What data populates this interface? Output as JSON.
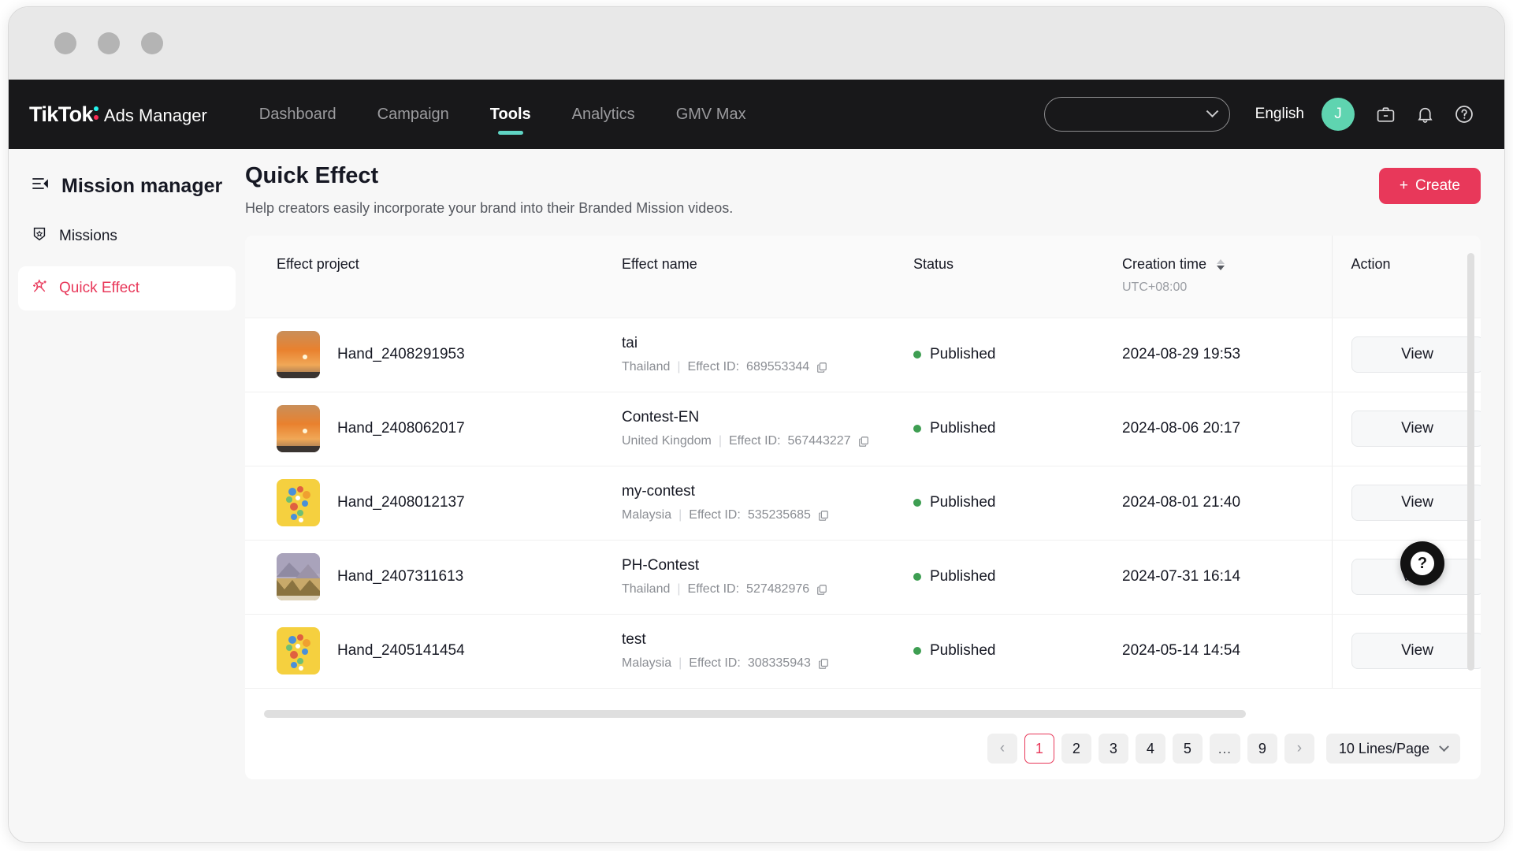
{
  "window": {
    "dots": [
      "window-dot-1",
      "window-dot-2",
      "window-dot-3"
    ]
  },
  "topnav": {
    "brand_primary": "TikTok",
    "brand_secondary": "Ads Manager",
    "items": [
      {
        "label": "Dashboard",
        "active": false
      },
      {
        "label": "Campaign",
        "active": false
      },
      {
        "label": "Tools",
        "active": true
      },
      {
        "label": "Analytics",
        "active": false
      },
      {
        "label": "GMV Max",
        "active": false
      }
    ],
    "account_select_value": "",
    "language": "English",
    "avatar_initial": "J",
    "icons": [
      "briefcase-icon",
      "bell-icon",
      "help-circle-icon"
    ],
    "accent_color": "#5fd4c4",
    "avatar_color": "#5fd4b0"
  },
  "sidebar": {
    "title": "Mission manager",
    "items": [
      {
        "label": "Missions",
        "icon": "shield-icon",
        "active": false
      },
      {
        "label": "Quick Effect",
        "icon": "sparkle-star-icon",
        "active": true
      }
    ],
    "active_color": "#e8385a"
  },
  "page": {
    "title": "Quick Effect",
    "subtitle": "Help creators easily incorporate your brand into their Branded Mission videos.",
    "create_label": "Create",
    "create_plus": "+",
    "create_color": "#e8385a"
  },
  "table": {
    "columns": [
      {
        "key": "effect_project",
        "label": "Effect project"
      },
      {
        "key": "effect_name",
        "label": "Effect name"
      },
      {
        "key": "status",
        "label": "Status"
      },
      {
        "key": "creation_time",
        "label": "Creation time",
        "sub": "UTC+08:00",
        "sortable": true
      },
      {
        "key": "action",
        "label": "Action"
      }
    ],
    "effect_id_prefix": "Effect ID:",
    "status_dot_color": "#3e9e52",
    "action_label": "View",
    "rows": [
      {
        "project": "Hand_2408291953",
        "thumb": "sunset",
        "name": "tai",
        "region": "Thailand",
        "effect_id": "689553344",
        "status": "Published",
        "creation_time": "2024-08-29 19:53",
        "action": "View"
      },
      {
        "project": "Hand_2408062017",
        "thumb": "sunset",
        "name": "Contest-EN",
        "region": "United Kingdom",
        "effect_id": "567443227",
        "status": "Published",
        "creation_time": "2024-08-06 20:17",
        "action": "View"
      },
      {
        "project": "Hand_2408012137",
        "thumb": "collage",
        "name": "my-contest",
        "region": "Malaysia",
        "effect_id": "535235685",
        "status": "Published",
        "creation_time": "2024-08-01 21:40",
        "action": "View"
      },
      {
        "project": "Hand_2407311613",
        "thumb": "mountain",
        "name": "PH-Contest",
        "region": "Thailand",
        "effect_id": "527482976",
        "status": "Published",
        "creation_time": "2024-07-31 16:14",
        "action": "View"
      },
      {
        "project": "Hand_2405141454",
        "thumb": "collage",
        "name": "test",
        "region": "Malaysia",
        "effect_id": "308335943",
        "status": "Published",
        "creation_time": "2024-05-14 14:54",
        "action": "View"
      }
    ]
  },
  "pagination": {
    "prev": "‹",
    "next": "›",
    "pages": [
      "1",
      "2",
      "3",
      "4",
      "5",
      "…",
      "9"
    ],
    "current": "1",
    "page_size": "10 Lines/Page"
  },
  "fab": {
    "label": "?",
    "name": "help-fab"
  }
}
